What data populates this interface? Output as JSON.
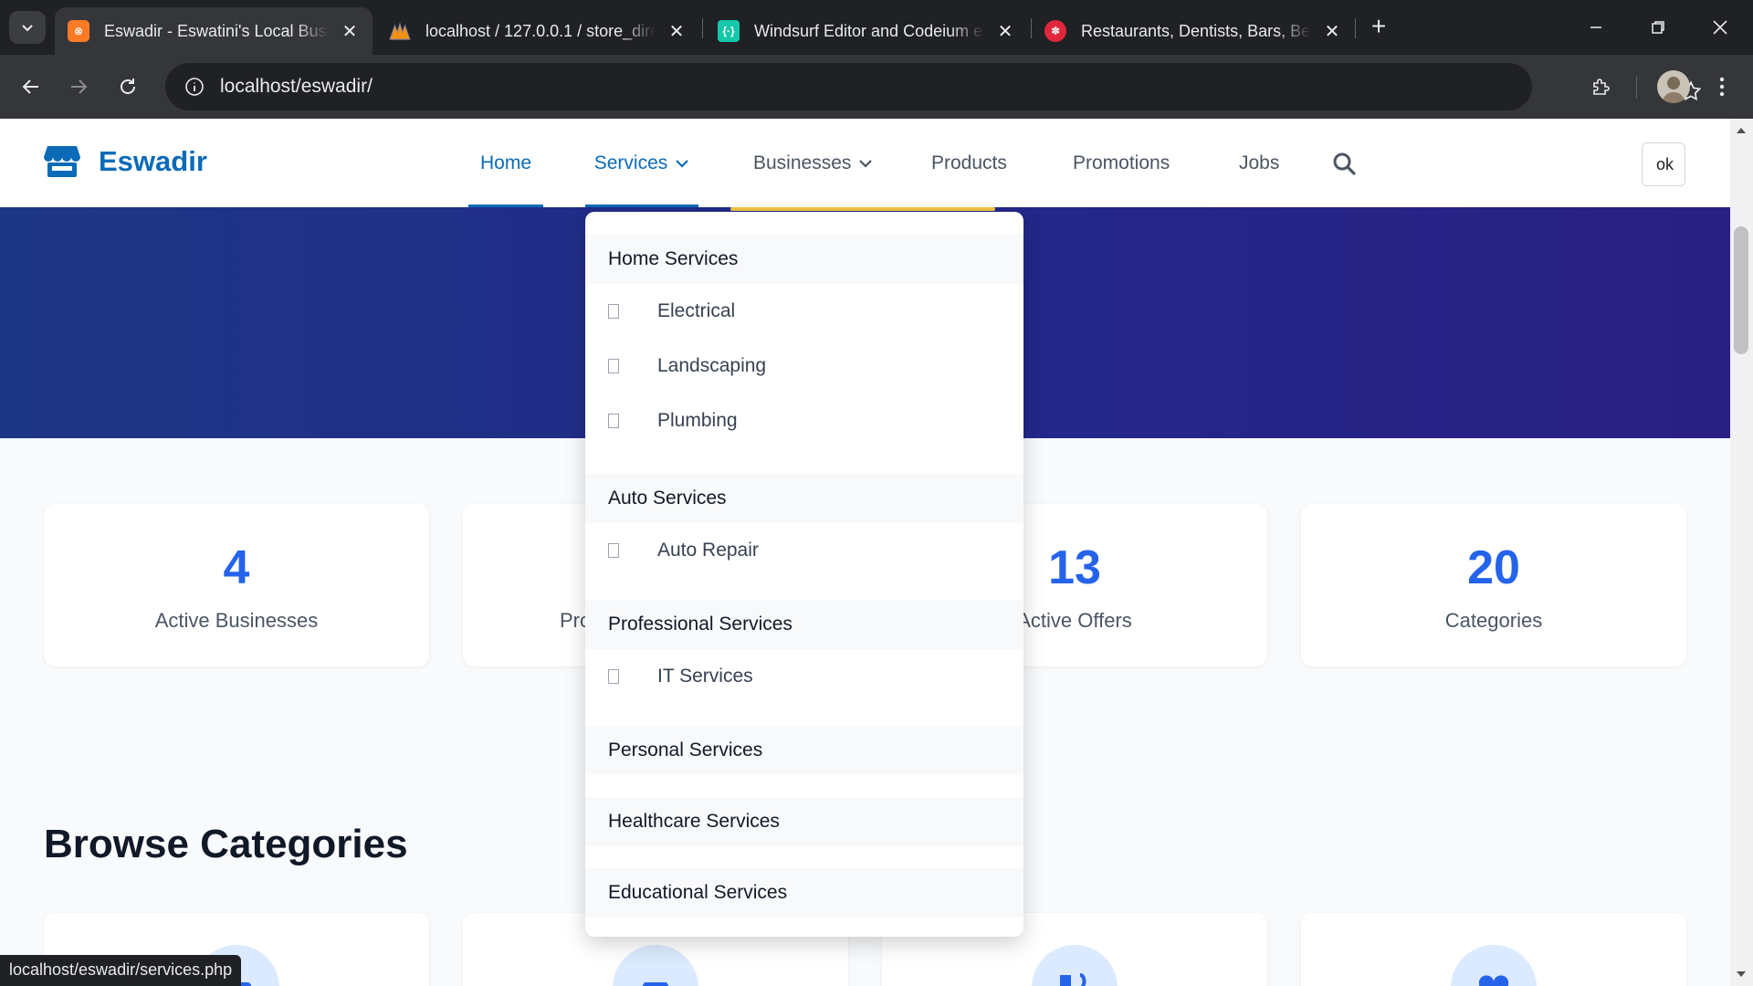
{
  "browser": {
    "tabs": [
      {
        "title": "Eswadir - Eswatini's Local Business Directory",
        "active": true,
        "favicon": "xampp-icon"
      },
      {
        "title": "localhost / 127.0.0.1 / store_directory",
        "active": false,
        "favicon": "phpmyadmin-icon"
      },
      {
        "title": "Windsurf Editor and Codeium extensions",
        "active": false,
        "favicon": "windsurf-icon"
      },
      {
        "title": "Restaurants, Dentists, Bars, Beauty Salons",
        "active": false,
        "favicon": "yelp-icon"
      }
    ],
    "url": "localhost/eswadir/",
    "status_url": "localhost/eswadir/services.php"
  },
  "site": {
    "brand": "Eswadir",
    "nav": {
      "home": "Home",
      "services": "Services",
      "businesses": "Businesses",
      "products": "Products",
      "promotions": "Promotions",
      "jobs": "Jobs"
    },
    "avatar_alt": "ok",
    "accent": "#0b6bb8"
  },
  "stats": [
    {
      "value": "4",
      "label": "Active Businesses"
    },
    {
      "value": "",
      "label": "Pro"
    },
    {
      "value": "13",
      "label": "Active Offers"
    },
    {
      "value": "20",
      "label": "Categories"
    }
  ],
  "browse": {
    "title": "Browse Categories"
  },
  "services_menu": {
    "home": {
      "heading": "Home Services",
      "items": [
        "Electrical",
        "Landscaping",
        "Plumbing"
      ]
    },
    "auto": {
      "heading": "Auto Services",
      "items": [
        "Auto Repair"
      ]
    },
    "professional": {
      "heading": "Professional Services",
      "items": [
        "IT Services"
      ]
    },
    "personal": {
      "heading": "Personal Services"
    },
    "healthcare": {
      "heading": "Healthcare Services"
    },
    "educational": {
      "heading": "Educational Services"
    }
  }
}
